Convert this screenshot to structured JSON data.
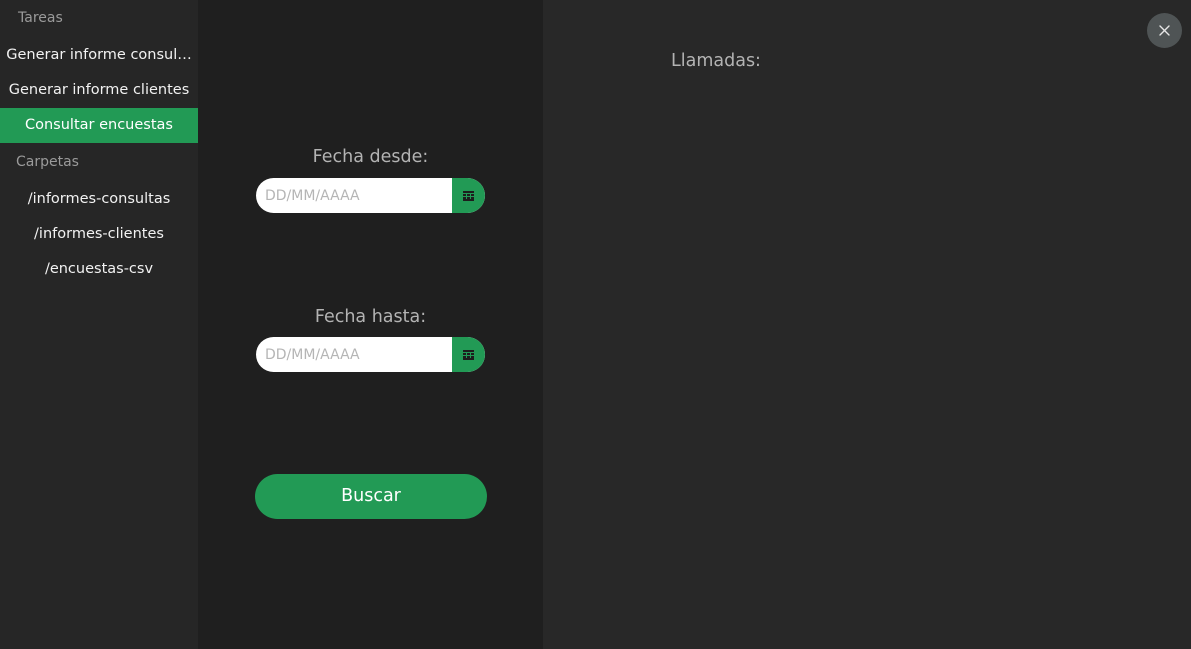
{
  "sidebar": {
    "tasks_title": "Tareas",
    "tasks": [
      {
        "label": "Generar informe consul…"
      },
      {
        "label": "Generar informe clientes"
      },
      {
        "label": "Consultar encuestas"
      }
    ],
    "folders_title": "Carpetas",
    "folders": [
      {
        "label": "/informes-consultas"
      },
      {
        "label": "/informes-clientes"
      },
      {
        "label": "/encuestas-csv"
      }
    ]
  },
  "form": {
    "from_label": "Fecha desde:",
    "from_placeholder": "DD/MM/AAAA",
    "to_label": "Fecha hasta:",
    "to_placeholder": "DD/MM/AAAA",
    "search_label": "Buscar"
  },
  "results": {
    "title": "Llamadas:"
  },
  "icons": {
    "calendar": "calendar-icon",
    "close": "close-icon"
  },
  "colors": {
    "accent": "#229a55",
    "sidebar_bg": "#262626",
    "panel_bg": "#1f1f1f",
    "content_bg": "#282828"
  }
}
